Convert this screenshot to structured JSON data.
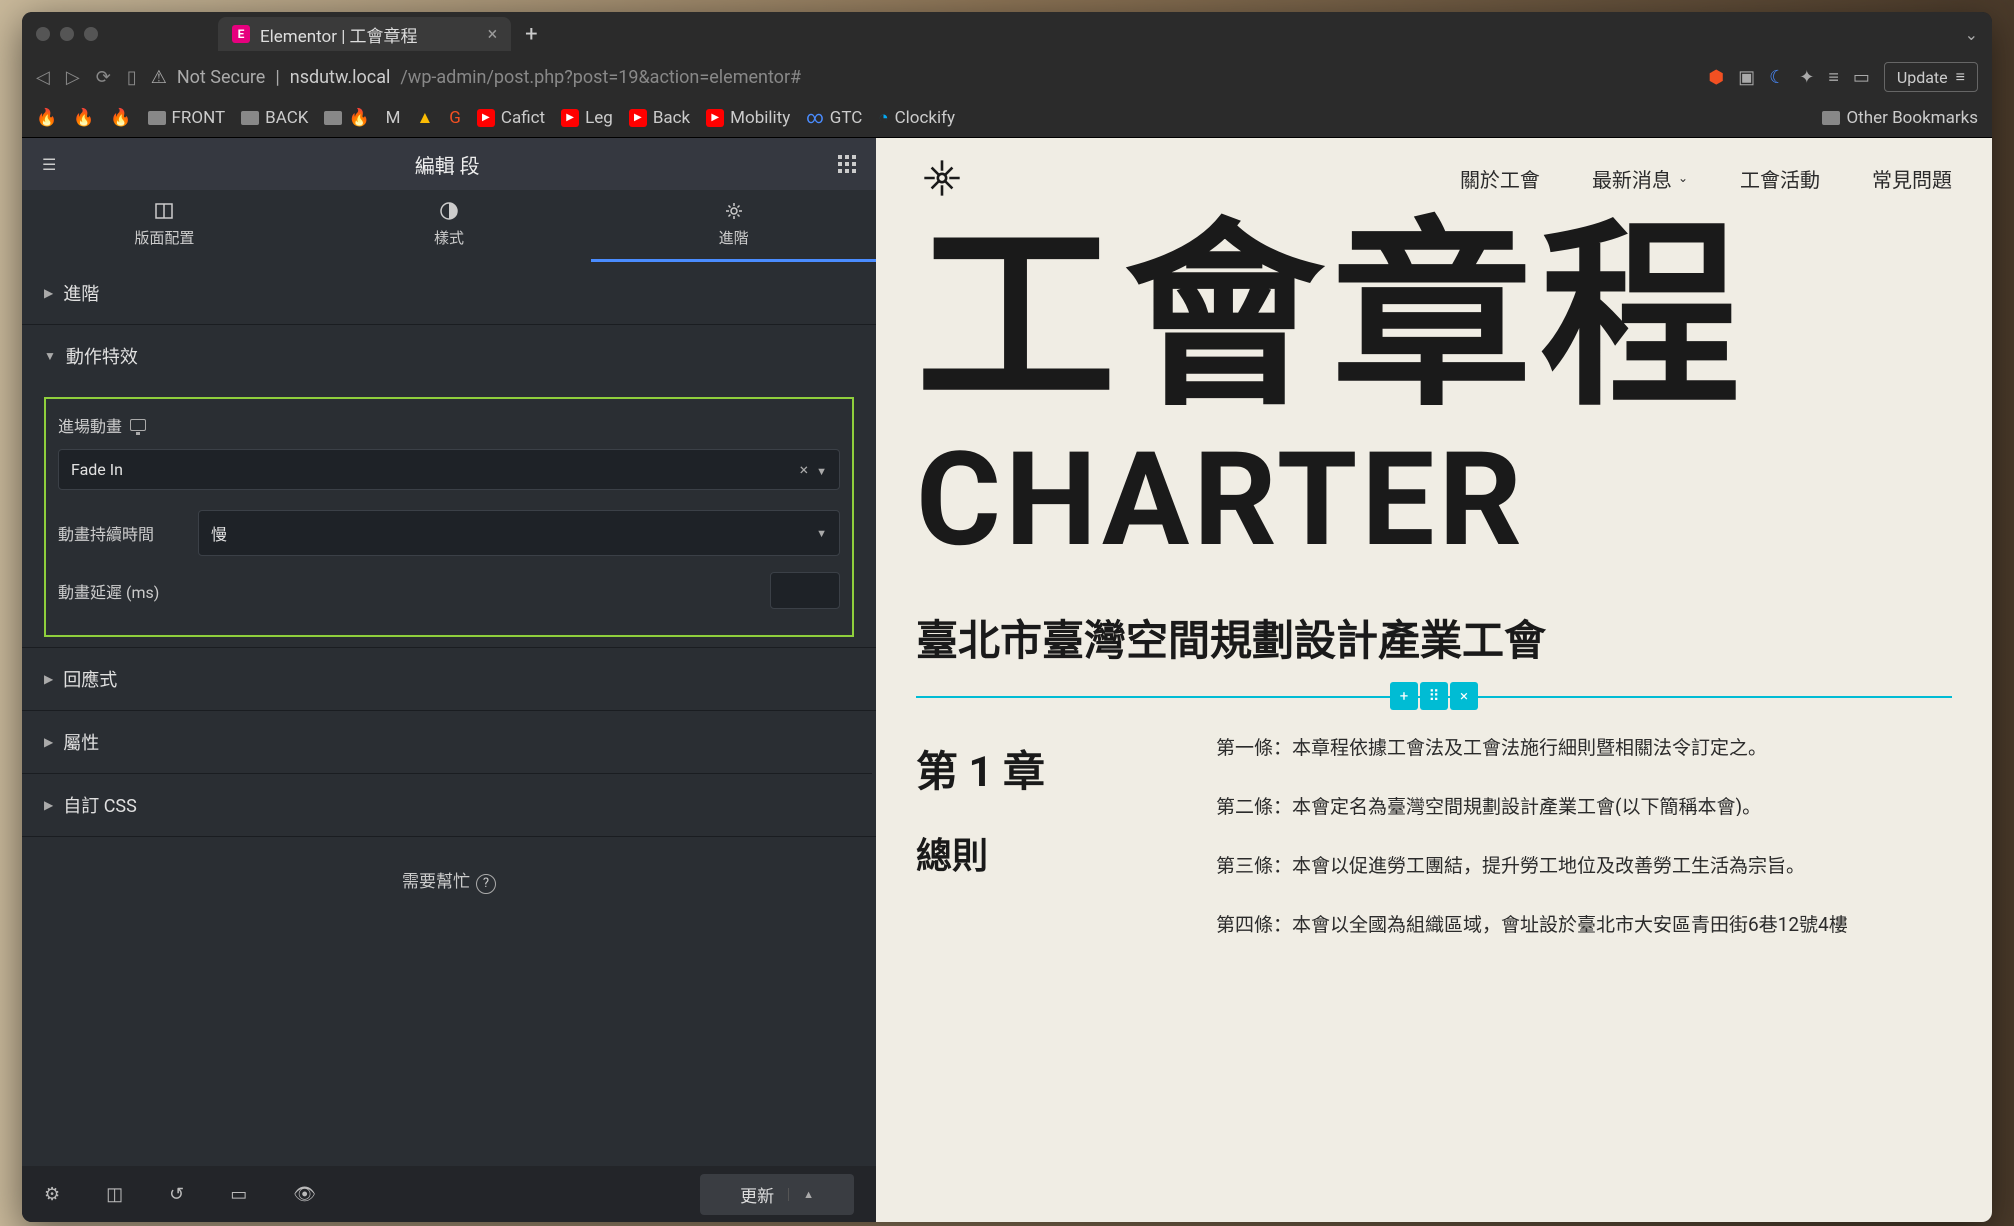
{
  "browser": {
    "tab_title": "Elementor | 工會章程",
    "url_host": "nsdutw.local",
    "url_path": "/wp-admin/post.php?post=19&action=elementor#",
    "not_secure": "Not Secure",
    "update": "Update"
  },
  "bookmarks": {
    "b1": "FRONT",
    "b2": "BACK",
    "b3": "Cafict",
    "b4": "Leg",
    "b5": "Back",
    "b6": "Mobility",
    "b7": "GTC",
    "b8": "Clockify",
    "other": "Other Bookmarks"
  },
  "panel": {
    "title": "編輯 段",
    "tab_layout": "版面配置",
    "tab_style": "樣式",
    "tab_advanced": "進階",
    "acc_advanced": "進階",
    "acc_motion": "動作特效",
    "acc_responsive": "回應式",
    "acc_attributes": "屬性",
    "acc_css": "自訂 CSS",
    "entrance_label": "進場動畫",
    "entrance_value": "Fade In",
    "duration_label": "動畫持續時間",
    "duration_value": "慢",
    "delay_label": "動畫延遲 (ms)",
    "delay_value": "",
    "help": "需要幫忙",
    "publish": "更新"
  },
  "preview": {
    "nav1": "關於工會",
    "nav2": "最新消息",
    "nav3": "工會活動",
    "nav4": "常見問題",
    "hero_zh": "工會章程",
    "hero_en": "CHARTER",
    "hero_sub": "臺北市臺灣空間規劃設計產業工會",
    "ch_title": "第 1 章",
    "ch_sub": "總則",
    "art1": "第一條：本章程依據工會法及工會法施行細則暨相關法令訂定之。",
    "art2": "第二條：本會定名為臺灣空間規劃設計產業工會(以下簡稱本會)。",
    "art3": "第三條：本會以促進勞工團結，提升勞工地位及改善勞工生活為宗旨。",
    "art4": "第四條：本會以全國為組織區域，會址設於臺北市大安區青田街6巷12號4樓"
  }
}
